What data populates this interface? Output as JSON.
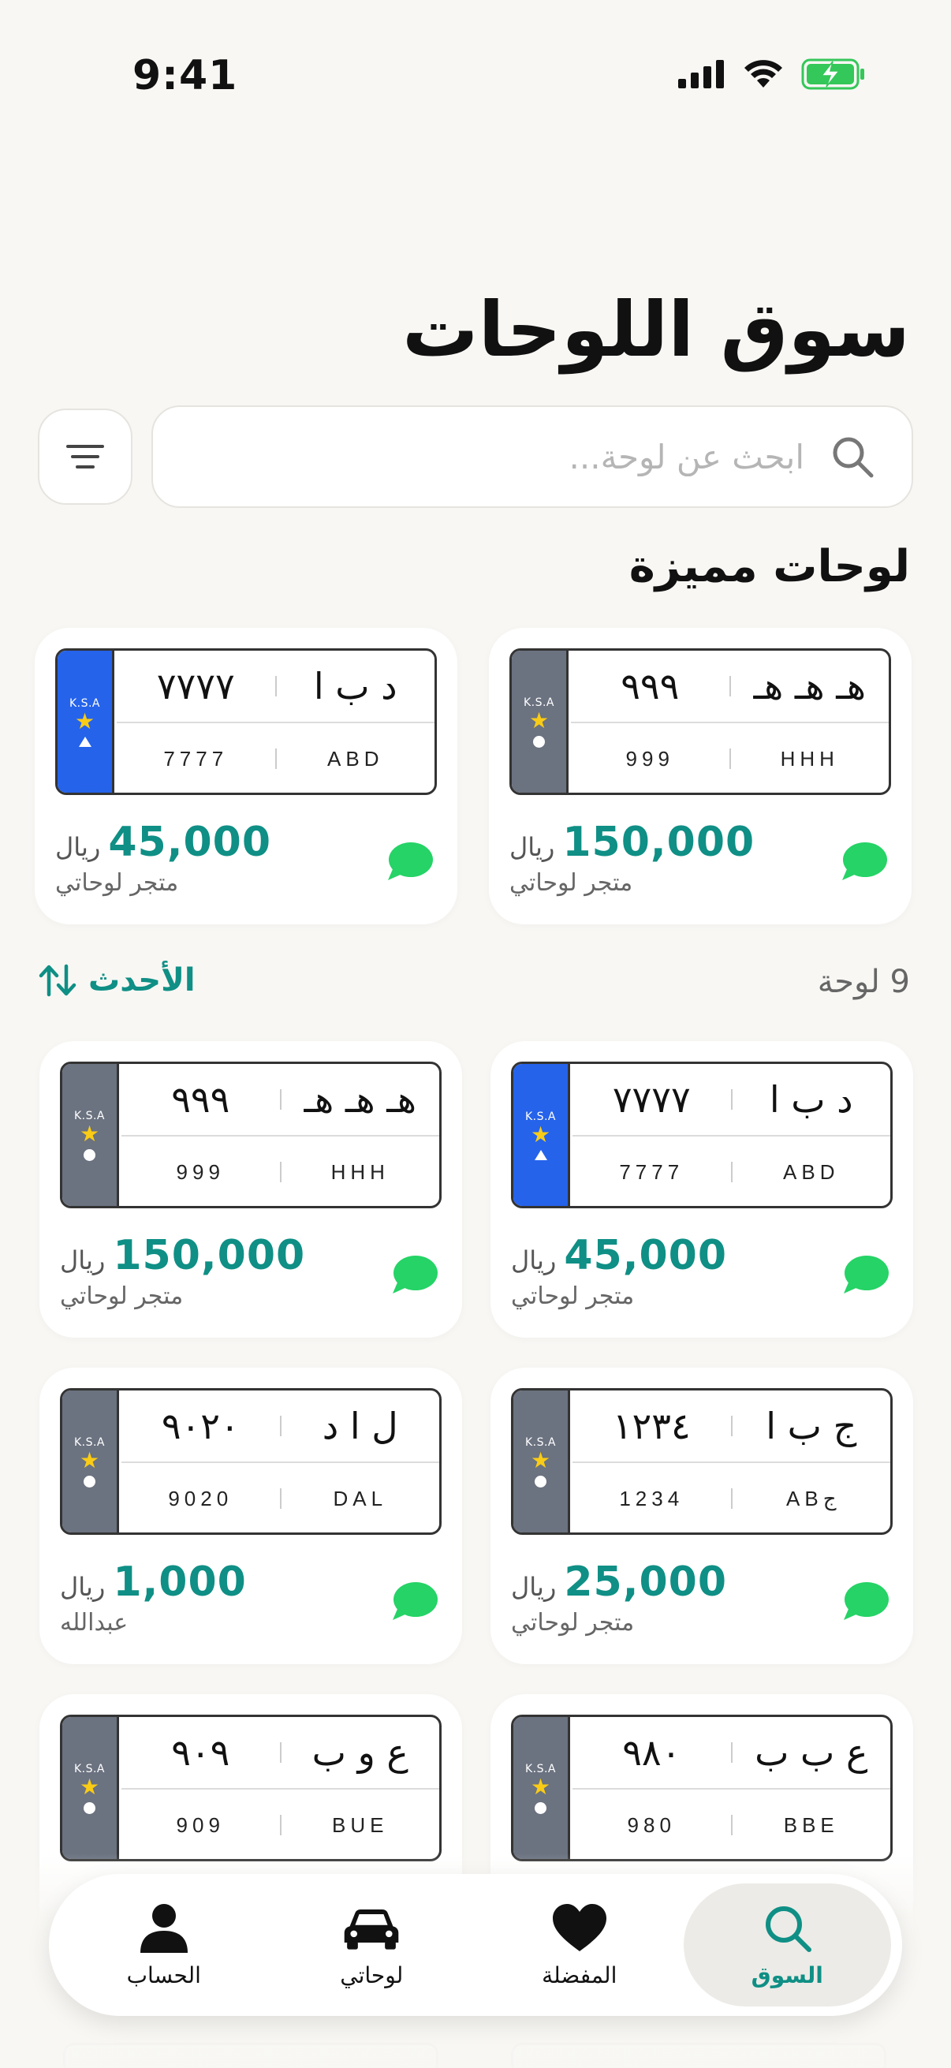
{
  "status_bar": {
    "time": "9:41"
  },
  "header": {
    "title": "سوق اللوحات"
  },
  "search": {
    "placeholder": "ابحث عن لوحة..."
  },
  "featured": {
    "title": "لوحات مميزة",
    "items": [
      {
        "plate": {
          "letters_ar": "هـ هـ هـ",
          "numbers_ar": "٩٩٩",
          "numbers_en": "999",
          "letters_en": "HHH",
          "ksa": "K.S.A"
        },
        "currency": "ريال",
        "price": "150,000",
        "seller": "متجر لوحاتي"
      },
      {
        "plate": {
          "letters_ar": "د ب ا",
          "numbers_ar": "٧٧٧٧",
          "numbers_en": "7777",
          "letters_en": "ABD",
          "ksa": "K.S.A"
        },
        "currency": "ريال",
        "price": "45,000",
        "seller": "متجر لوحاتي"
      }
    ]
  },
  "listing": {
    "count": "9 لوحة",
    "sort_label": "الأحدث",
    "items": [
      {
        "plate": {
          "letters_ar": "د ب ا",
          "numbers_ar": "٧٧٧٧",
          "numbers_en": "7777",
          "letters_en": "ABD",
          "ksa": "K.S.A"
        },
        "currency": "ريال",
        "price": "45,000",
        "seller": "متجر لوحاتي"
      },
      {
        "plate": {
          "letters_ar": "هـ هـ هـ",
          "numbers_ar": "٩٩٩",
          "numbers_en": "999",
          "letters_en": "HHH",
          "ksa": "K.S.A"
        },
        "currency": "ريال",
        "price": "150,000",
        "seller": "متجر لوحاتي"
      },
      {
        "plate": {
          "letters_ar": "ج ب ا",
          "numbers_ar": "١٢٣٤",
          "numbers_en": "1234",
          "letters_en": "ABج",
          "ksa": "K.S.A"
        },
        "currency": "ريال",
        "price": "25,000",
        "seller": "متجر لوحاتي"
      },
      {
        "plate": {
          "letters_ar": "ل ا د",
          "numbers_ar": "٩٠٢٠",
          "numbers_en": "9020",
          "letters_en": "DAL",
          "ksa": "K.S.A"
        },
        "currency": "ريال",
        "price": "1,000",
        "seller": "عبدالله"
      },
      {
        "plate": {
          "letters_ar": "ع ب ب",
          "numbers_ar": "٩٨٠",
          "numbers_en": "980",
          "letters_en": "BBE",
          "ksa": "K.S.A"
        }
      },
      {
        "plate": {
          "letters_ar": "ع و ب",
          "numbers_ar": "٩٠٩",
          "numbers_en": "909",
          "letters_en": "BUE",
          "ksa": "K.S.A"
        }
      }
    ]
  },
  "nav": {
    "items": [
      {
        "label": "السوق",
        "icon": "search-icon",
        "active": true
      },
      {
        "label": "المفضلة",
        "icon": "heart-icon",
        "active": false
      },
      {
        "label": "لوحاتي",
        "icon": "car-icon",
        "active": false
      },
      {
        "label": "الحساب",
        "icon": "person-icon",
        "active": false
      }
    ]
  },
  "colors": {
    "accent": "#0f8f85",
    "chat": "#25d366",
    "plate_blue": "#2563eb",
    "plate_gray": "#6b7280",
    "star": "#facc15"
  }
}
